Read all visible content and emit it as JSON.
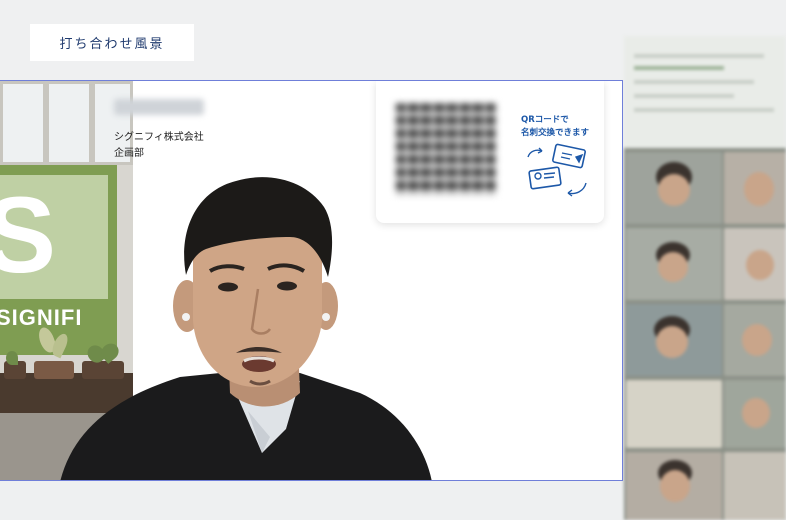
{
  "caption": {
    "title": "打ち合わせ風景"
  },
  "nameplate": {
    "company": "シグニフィ株式会社",
    "department": "企画部"
  },
  "qr_card": {
    "line1": "QRコードで",
    "line2": "名刺交換できます"
  },
  "background_logo": {
    "letter": "S",
    "word": "SIGNIFI"
  },
  "colors": {
    "frame_border": "#6f7fd9",
    "caption_text": "#1f3a6e",
    "qr_text": "#1d58a8",
    "logo_green": "#7f9d52"
  },
  "icons": [
    "qr-code-icon",
    "business-card-exchange-icon"
  ]
}
